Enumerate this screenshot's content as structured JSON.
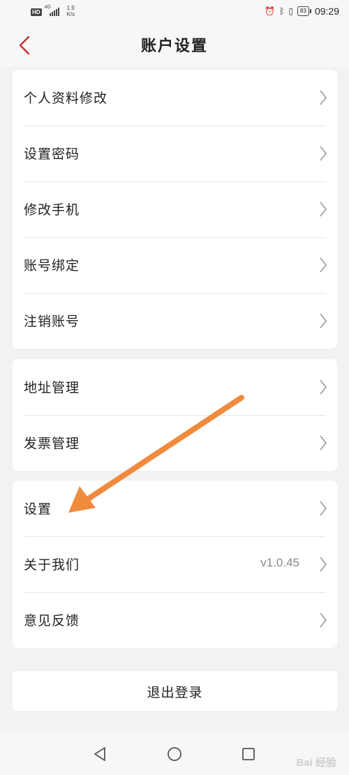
{
  "status_bar": {
    "hd": "HD",
    "network": "4G",
    "speed_value": "1.9",
    "speed_unit": "K/s",
    "battery": "83",
    "time": "09:29"
  },
  "header": {
    "title": "账户设置"
  },
  "groups": [
    {
      "items": [
        {
          "label": "个人资料修改"
        },
        {
          "label": "设置密码"
        },
        {
          "label": "修改手机"
        },
        {
          "label": "账号绑定"
        },
        {
          "label": "注销账号"
        }
      ]
    },
    {
      "items": [
        {
          "label": "地址管理"
        },
        {
          "label": "发票管理"
        }
      ]
    },
    {
      "items": [
        {
          "label": "设置"
        },
        {
          "label": "关于我们",
          "value": "v1.0.45"
        },
        {
          "label": "意见反馈"
        }
      ]
    }
  ],
  "logout": {
    "label": "退出登录"
  },
  "watermark": "Bai 经验",
  "colors": {
    "accent_red": "#c7353a",
    "annotation_arrow": "#f08a3c"
  }
}
